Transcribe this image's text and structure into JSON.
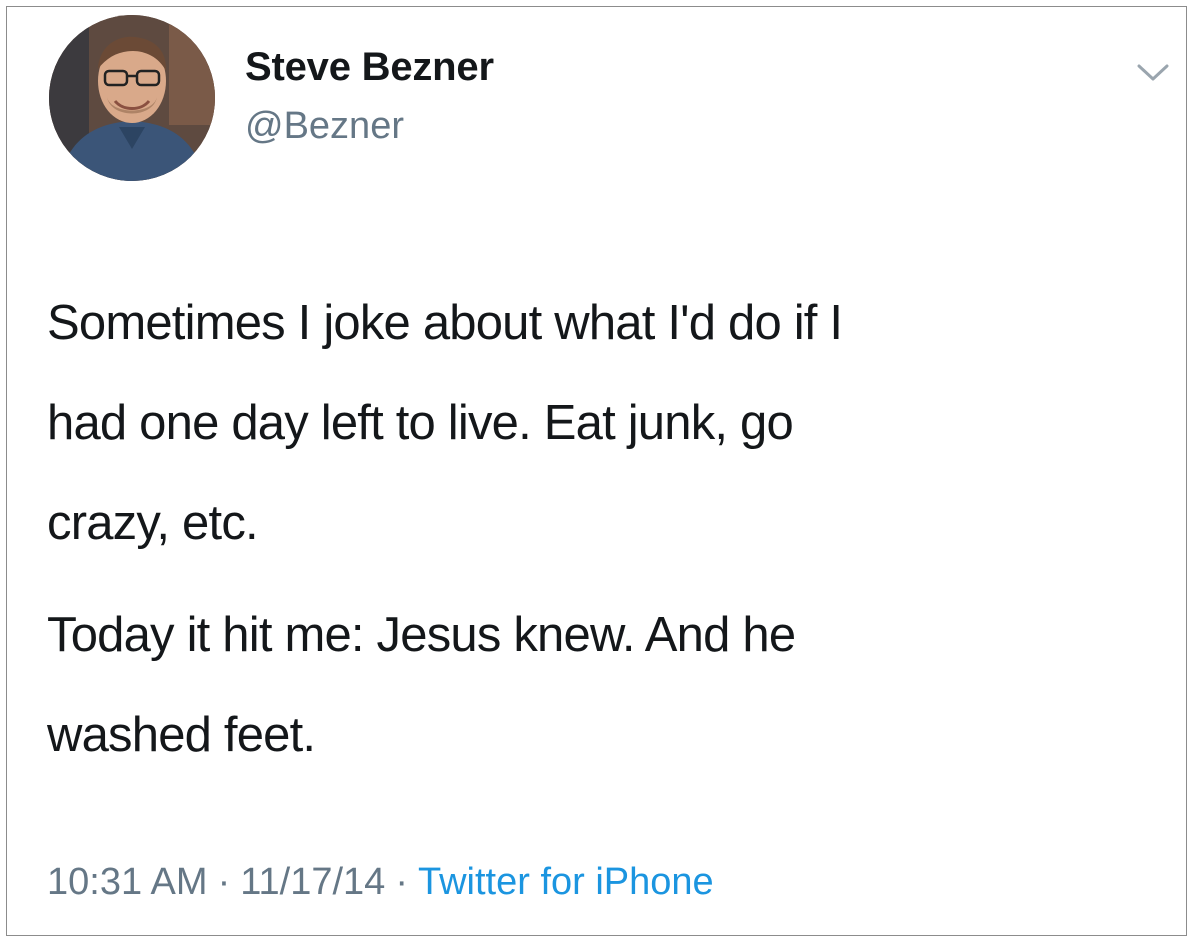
{
  "user": {
    "display_name": "Steve Bezner",
    "handle": "@Bezner",
    "avatar_icon": "user-avatar"
  },
  "menu": {
    "icon": "chevron-down-icon"
  },
  "tweet": {
    "paragraphs": [
      "Sometimes I joke about what I'd do if I\nhad one day left to live. Eat junk, go\ncrazy, etc.",
      "Today it hit me: Jesus knew. And he\nwashed feet."
    ]
  },
  "meta": {
    "time": "10:31 AM",
    "separator": "·",
    "date": "11/17/14",
    "source": "Twitter for iPhone"
  },
  "colors": {
    "text": "#14171a",
    "secondary": "#657786",
    "link": "#1b95e0",
    "border": "#8c8c8c"
  }
}
